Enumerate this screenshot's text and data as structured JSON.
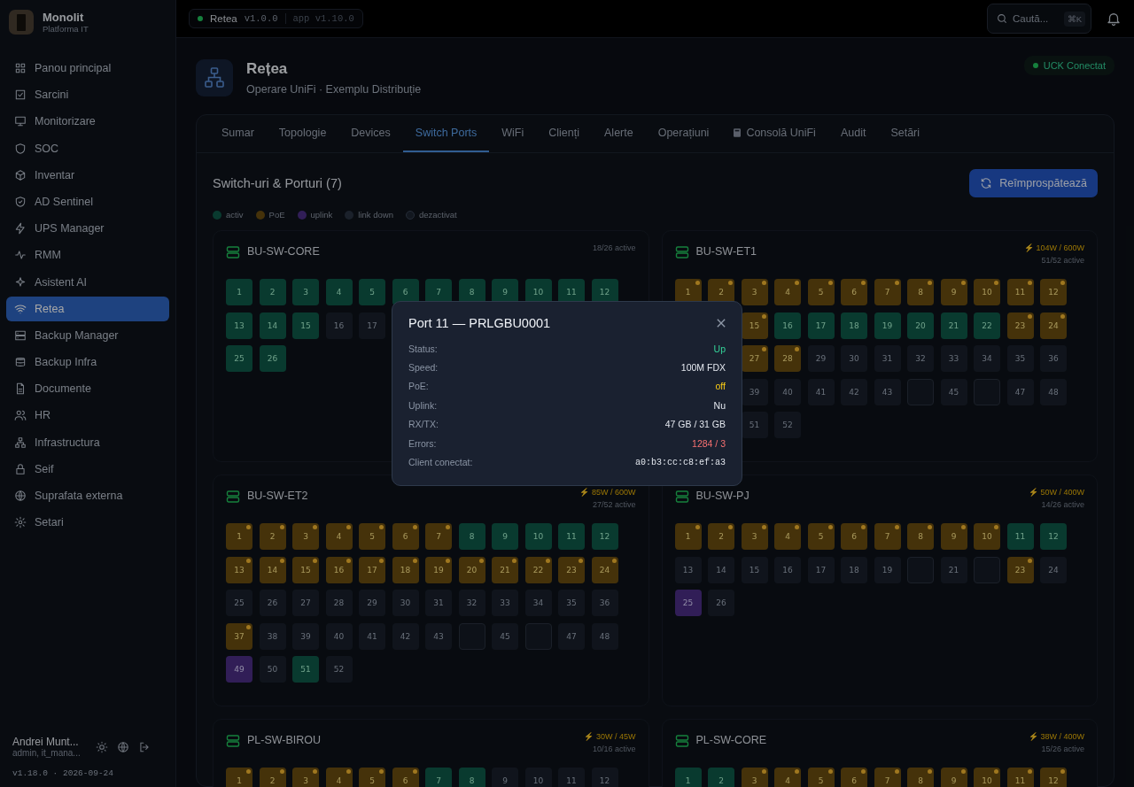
{
  "brand": {
    "name": "Monolit",
    "subtitle": "Platforma IT"
  },
  "sidebar": {
    "items": [
      {
        "label": "Panou principal",
        "selected": false
      },
      {
        "label": "Sarcini",
        "selected": false
      },
      {
        "label": "Monitorizare",
        "selected": false
      },
      {
        "label": "SOC",
        "selected": false
      },
      {
        "label": "Inventar",
        "selected": false
      },
      {
        "label": "AD Sentinel",
        "selected": false
      },
      {
        "label": "UPS Manager",
        "selected": false
      },
      {
        "label": "RMM",
        "selected": false
      },
      {
        "label": "Asistent AI",
        "selected": false
      },
      {
        "label": "Retea",
        "selected": true
      },
      {
        "label": "Backup Manager",
        "selected": false
      },
      {
        "label": "Backup Infra",
        "selected": false
      },
      {
        "label": "Documente",
        "selected": false
      },
      {
        "label": "HR",
        "selected": false
      },
      {
        "label": "Infrastructura",
        "selected": false
      },
      {
        "label": "Seif",
        "selected": false
      },
      {
        "label": "Suprafata externa",
        "selected": false
      },
      {
        "label": "Setari",
        "selected": false
      }
    ],
    "user": {
      "name": "Andrei Munt...",
      "role": "admin, it_mana..."
    },
    "version": "v1.18.0 · 2026-09-24"
  },
  "topbar": {
    "module": "Retea",
    "module_version": "v1.0.0",
    "app_version": "app v1.10.0",
    "search": {
      "placeholder": "Caută...",
      "shortcut": "⌘K"
    }
  },
  "header": {
    "title": "Rețea",
    "subtitle": "Operare UniFi · Exemplu Distribuție",
    "status": "UCK Conectat"
  },
  "tabs": [
    {
      "label": "Sumar",
      "selected": false,
      "icon": false
    },
    {
      "label": "Topologie",
      "selected": false,
      "icon": false
    },
    {
      "label": "Devices",
      "selected": false,
      "icon": false
    },
    {
      "label": "Switch Ports",
      "selected": true,
      "icon": false
    },
    {
      "label": "WiFi",
      "selected": false,
      "icon": false
    },
    {
      "label": "Clienți",
      "selected": false,
      "icon": false
    },
    {
      "label": "Alerte",
      "selected": false,
      "icon": false
    },
    {
      "label": "Operațiuni",
      "selected": false,
      "icon": false
    },
    {
      "label": "Consolă UniFi",
      "selected": false,
      "icon": true
    },
    {
      "label": "Audit",
      "selected": false,
      "icon": false
    },
    {
      "label": "Setări",
      "selected": false,
      "icon": false
    }
  ],
  "section": {
    "title": "Switch-uri & Porturi (7)",
    "refresh_button": "Reîmprospătează"
  },
  "legend": [
    {
      "label": "activ",
      "kind": "active"
    },
    {
      "label": "PoE",
      "kind": "poe"
    },
    {
      "label": "uplink",
      "kind": "uplink"
    },
    {
      "label": "link down",
      "kind": "down"
    },
    {
      "label": "dezactivat",
      "kind": "disabled"
    }
  ],
  "switches": [
    {
      "name": "BU-SW-CORE",
      "active": "18/26 active",
      "ports": [
        {
          "n": "1",
          "kind": "active"
        },
        {
          "n": "2",
          "kind": "active"
        },
        {
          "n": "3",
          "kind": "active"
        },
        {
          "n": "4",
          "kind": "active"
        },
        {
          "n": "5",
          "kind": "active"
        },
        {
          "n": "6",
          "kind": "active"
        },
        {
          "n": "7",
          "kind": "active"
        },
        {
          "n": "8",
          "kind": "active"
        },
        {
          "n": "9",
          "kind": "active"
        },
        {
          "n": "10",
          "kind": "active"
        },
        {
          "n": "11",
          "kind": "active"
        },
        {
          "n": "12",
          "kind": "active"
        },
        {
          "n": "13",
          "kind": "active"
        },
        {
          "n": "14",
          "kind": "active"
        },
        {
          "n": "15",
          "kind": "active"
        },
        {
          "n": "16",
          "kind": "down"
        },
        {
          "n": "17",
          "kind": "down"
        },
        {
          "kind": "hidden"
        },
        {
          "kind": "hidden"
        },
        {
          "kind": "hidden"
        },
        {
          "kind": "hidden"
        },
        {
          "kind": "hidden"
        },
        {
          "kind": "hidden"
        },
        {
          "kind": "hidden"
        },
        {
          "n": "25",
          "kind": "active"
        },
        {
          "n": "26",
          "kind": "active"
        }
      ]
    },
    {
      "name": "BU-SW-ET1",
      "power": "⚡ 104W / 600W",
      "active": "51/52 active",
      "ports": [
        {
          "n": "1",
          "kind": "poe"
        },
        {
          "n": "2",
          "kind": "poe"
        },
        {
          "n": "3",
          "kind": "poe"
        },
        {
          "n": "4",
          "kind": "poe"
        },
        {
          "n": "5",
          "kind": "poe"
        },
        {
          "n": "6",
          "kind": "poe"
        },
        {
          "n": "7",
          "kind": "poe"
        },
        {
          "n": "8",
          "kind": "poe"
        },
        {
          "n": "9",
          "kind": "poe"
        },
        {
          "n": "10",
          "kind": "poe"
        },
        {
          "n": "11",
          "kind": "poe"
        },
        {
          "n": "12",
          "kind": "poe"
        },
        {
          "kind": "hidden"
        },
        {
          "kind": "hidden"
        },
        {
          "n": "15",
          "kind": "poe"
        },
        {
          "n": "16",
          "kind": "active"
        },
        {
          "n": "17",
          "kind": "active"
        },
        {
          "n": "18",
          "kind": "active"
        },
        {
          "n": "19",
          "kind": "active"
        },
        {
          "n": "20",
          "kind": "active"
        },
        {
          "n": "21",
          "kind": "active"
        },
        {
          "n": "22",
          "kind": "active"
        },
        {
          "n": "23",
          "kind": "poe"
        },
        {
          "n": "24",
          "kind": "poe"
        },
        {
          "kind": "hidden"
        },
        {
          "kind": "hidden"
        },
        {
          "n": "27",
          "kind": "poe"
        },
        {
          "n": "28",
          "kind": "poe"
        },
        {
          "n": "29",
          "kind": "down"
        },
        {
          "n": "30",
          "kind": "down"
        },
        {
          "n": "31",
          "kind": "down"
        },
        {
          "n": "32",
          "kind": "down"
        },
        {
          "n": "33",
          "kind": "down"
        },
        {
          "n": "34",
          "kind": "down"
        },
        {
          "n": "35",
          "kind": "down"
        },
        {
          "n": "36",
          "kind": "down"
        },
        {
          "kind": "hidden"
        },
        {
          "kind": "hidden"
        },
        {
          "n": "39",
          "kind": "down"
        },
        {
          "n": "40",
          "kind": "down"
        },
        {
          "n": "41",
          "kind": "down"
        },
        {
          "n": "42",
          "kind": "down"
        },
        {
          "n": "43",
          "kind": "down"
        },
        {
          "kind": "disabled"
        },
        {
          "n": "45",
          "kind": "down"
        },
        {
          "kind": "disabled"
        },
        {
          "n": "47",
          "kind": "down"
        },
        {
          "n": "48",
          "kind": "down"
        },
        {
          "kind": "hidden"
        },
        {
          "kind": "hidden"
        },
        {
          "n": "51",
          "kind": "down"
        },
        {
          "n": "52",
          "kind": "down"
        }
      ]
    },
    {
      "name": "BU-SW-ET2",
      "power": "⚡ 85W / 600W",
      "active": "27/52 active",
      "ports": [
        {
          "n": "1",
          "kind": "poe"
        },
        {
          "n": "2",
          "kind": "poe"
        },
        {
          "n": "3",
          "kind": "poe"
        },
        {
          "n": "4",
          "kind": "poe"
        },
        {
          "n": "5",
          "kind": "poe"
        },
        {
          "n": "6",
          "kind": "poe"
        },
        {
          "n": "7",
          "kind": "poe"
        },
        {
          "n": "8",
          "kind": "active"
        },
        {
          "n": "9",
          "kind": "active"
        },
        {
          "n": "10",
          "kind": "active"
        },
        {
          "n": "11",
          "kind": "active"
        },
        {
          "n": "12",
          "kind": "active"
        },
        {
          "n": "13",
          "kind": "poe"
        },
        {
          "n": "14",
          "kind": "poe"
        },
        {
          "n": "15",
          "kind": "poe"
        },
        {
          "n": "16",
          "kind": "poe"
        },
        {
          "n": "17",
          "kind": "poe"
        },
        {
          "n": "18",
          "kind": "poe"
        },
        {
          "n": "19",
          "kind": "poe"
        },
        {
          "n": "20",
          "kind": "poe"
        },
        {
          "n": "21",
          "kind": "poe"
        },
        {
          "n": "22",
          "kind": "poe"
        },
        {
          "n": "23",
          "kind": "poe"
        },
        {
          "n": "24",
          "kind": "poe"
        },
        {
          "n": "25",
          "kind": "down"
        },
        {
          "n": "26",
          "kind": "down"
        },
        {
          "n": "27",
          "kind": "down"
        },
        {
          "n": "28",
          "kind": "down"
        },
        {
          "n": "29",
          "kind": "down"
        },
        {
          "n": "30",
          "kind": "down"
        },
        {
          "n": "31",
          "kind": "down"
        },
        {
          "n": "32",
          "kind": "down"
        },
        {
          "n": "33",
          "kind": "down"
        },
        {
          "n": "34",
          "kind": "down"
        },
        {
          "n": "35",
          "kind": "down"
        },
        {
          "n": "36",
          "kind": "down"
        },
        {
          "n": "37",
          "kind": "poe"
        },
        {
          "n": "38",
          "kind": "down"
        },
        {
          "n": "39",
          "kind": "down"
        },
        {
          "n": "40",
          "kind": "down"
        },
        {
          "n": "41",
          "kind": "down"
        },
        {
          "n": "42",
          "kind": "down"
        },
        {
          "n": "43",
          "kind": "down"
        },
        {
          "kind": "disabled"
        },
        {
          "n": "45",
          "kind": "down"
        },
        {
          "kind": "disabled"
        },
        {
          "n": "47",
          "kind": "down"
        },
        {
          "n": "48",
          "kind": "down"
        },
        {
          "n": "49",
          "kind": "uplink"
        },
        {
          "n": "50",
          "kind": "down"
        },
        {
          "n": "51",
          "kind": "active"
        },
        {
          "n": "52",
          "kind": "down"
        }
      ]
    },
    {
      "name": "BU-SW-PJ",
      "power": "⚡ 50W / 400W",
      "active": "14/26 active",
      "ports": [
        {
          "n": "1",
          "kind": "poe"
        },
        {
          "n": "2",
          "kind": "poe"
        },
        {
          "n": "3",
          "kind": "poe"
        },
        {
          "n": "4",
          "kind": "poe"
        },
        {
          "n": "5",
          "kind": "poe"
        },
        {
          "n": "6",
          "kind": "poe"
        },
        {
          "n": "7",
          "kind": "poe"
        },
        {
          "n": "8",
          "kind": "poe"
        },
        {
          "n": "9",
          "kind": "poe"
        },
        {
          "n": "10",
          "kind": "poe"
        },
        {
          "n": "11",
          "kind": "active"
        },
        {
          "n": "12",
          "kind": "active"
        },
        {
          "n": "13",
          "kind": "down"
        },
        {
          "n": "14",
          "kind": "down"
        },
        {
          "n": "15",
          "kind": "down"
        },
        {
          "n": "16",
          "kind": "down"
        },
        {
          "n": "17",
          "kind": "down"
        },
        {
          "n": "18",
          "kind": "down"
        },
        {
          "n": "19",
          "kind": "down"
        },
        {
          "kind": "disabled"
        },
        {
          "n": "21",
          "kind": "down"
        },
        {
          "kind": "disabled"
        },
        {
          "n": "23",
          "kind": "poe"
        },
        {
          "n": "24",
          "kind": "down"
        },
        {
          "n": "25",
          "kind": "uplink"
        },
        {
          "n": "26",
          "kind": "down"
        }
      ]
    },
    {
      "name": "PL-SW-BIROU",
      "power": "⚡ 30W / 45W",
      "active": "10/16 active",
      "ports": [
        {
          "n": "1",
          "kind": "poe"
        },
        {
          "n": "2",
          "kind": "poe"
        },
        {
          "n": "3",
          "kind": "poe"
        },
        {
          "n": "4",
          "kind": "poe"
        },
        {
          "n": "5",
          "kind": "poe"
        },
        {
          "n": "6",
          "kind": "poe"
        },
        {
          "n": "7",
          "kind": "active"
        },
        {
          "n": "8",
          "kind": "active"
        },
        {
          "n": "9",
          "kind": "down"
        },
        {
          "n": "10",
          "kind": "down"
        },
        {
          "n": "11",
          "kind": "down"
        },
        {
          "n": "12",
          "kind": "down"
        }
      ]
    },
    {
      "name": "PL-SW-CORE",
      "power": "⚡ 38W / 400W",
      "active": "15/26 active",
      "ports": [
        {
          "n": "1",
          "kind": "active"
        },
        {
          "n": "2",
          "kind": "active"
        },
        {
          "n": "3",
          "kind": "poe"
        },
        {
          "n": "4",
          "kind": "poe"
        },
        {
          "n": "5",
          "kind": "poe"
        },
        {
          "n": "6",
          "kind": "poe"
        },
        {
          "n": "7",
          "kind": "poe"
        },
        {
          "n": "8",
          "kind": "poe"
        },
        {
          "n": "9",
          "kind": "poe"
        },
        {
          "n": "10",
          "kind": "poe"
        },
        {
          "n": "11",
          "kind": "poe"
        },
        {
          "n": "12",
          "kind": "poe"
        }
      ]
    }
  ],
  "modal": {
    "title": "Port 11 — PRLGBU0001",
    "rows": [
      {
        "label": "Status:",
        "value": "Up",
        "kind": "ok"
      },
      {
        "label": "Speed:",
        "value": "100M FDX",
        "kind": "plain"
      },
      {
        "label": "PoE:",
        "value": "off",
        "kind": "warn"
      },
      {
        "label": "Uplink:",
        "value": "Nu",
        "kind": "plain"
      },
      {
        "label": "RX/TX:",
        "value": "47 GB / 31 GB",
        "kind": "plain"
      },
      {
        "label": "Errors:",
        "value": "1284 / 3",
        "kind": "bad"
      },
      {
        "label": "Client conectat:",
        "value": "a0:b3:cc:c8:ef:a3",
        "kind": "mono"
      }
    ]
  }
}
